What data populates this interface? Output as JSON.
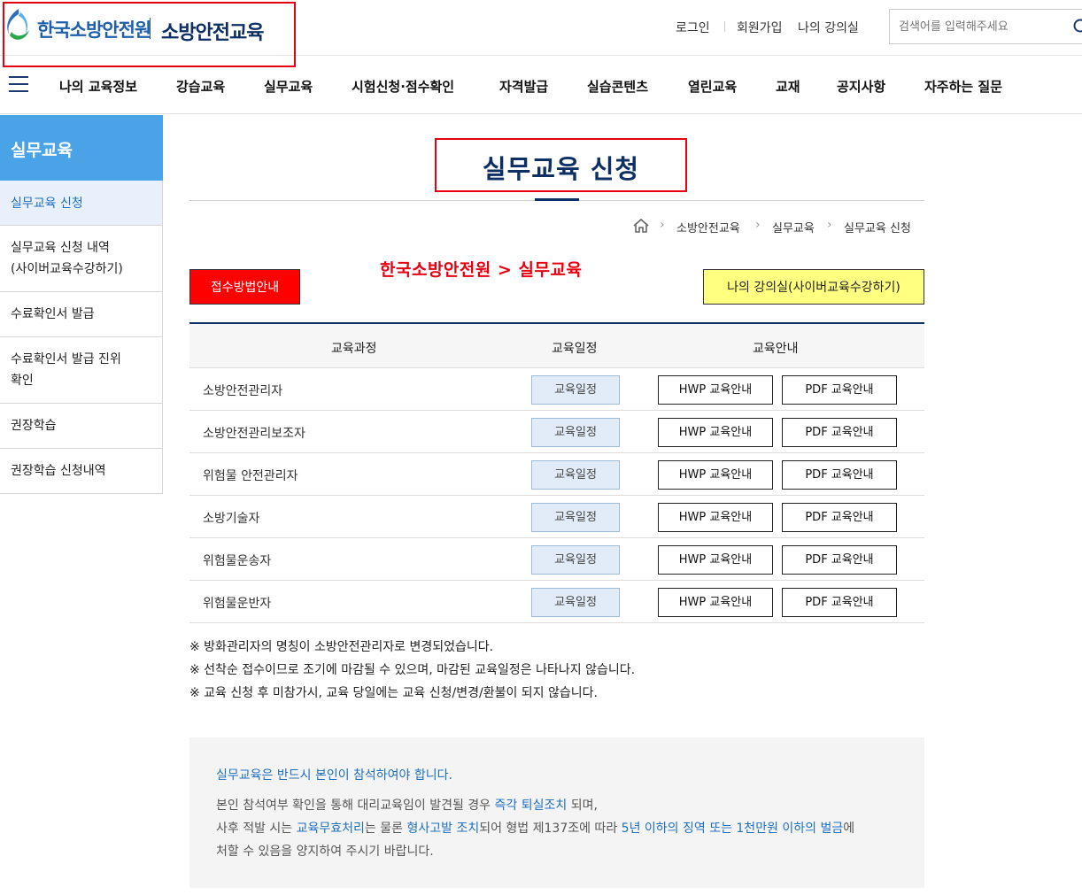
{
  "header": {
    "org_name": "한국소방안전원",
    "site_name": "소방안전교육",
    "util_links": [
      "로그인",
      "회원가입",
      "나의 강의실"
    ],
    "search_placeholder": "검색어를 입력해주세요"
  },
  "gnb": {
    "items": [
      "나의 교육정보",
      "강습교육",
      "실무교육",
      "시험신청·점수확인",
      "자격발급",
      "실습콘텐츠",
      "열린교육",
      "교재",
      "공지사항",
      "자주하는 질문"
    ]
  },
  "sidebar": {
    "title": "실무교육",
    "items": [
      {
        "label": "실무교육 신청",
        "active": true
      },
      {
        "label": "실무교육 신청 내역",
        "label2": "(사이버교육수강하기)"
      },
      {
        "label": "수료확인서 발급"
      },
      {
        "label": "수료확인서 발급 진위",
        "label2": "확인"
      },
      {
        "label": "권장학습"
      },
      {
        "label": "권장학습 신청내역"
      }
    ]
  },
  "main": {
    "title": "실무교육 신청",
    "breadcrumb": [
      "소방안전교육",
      "실무교육",
      "실무교육 신청"
    ],
    "annotation": "한국소방안전원 > 실무교육",
    "receipt_button": "접수방법안내",
    "lecture_button": "나의 강의실(사이버교육수강하기)",
    "table": {
      "headers": [
        "교육과정",
        "교육일정",
        "교육안내"
      ],
      "rows": [
        {
          "course": "소방안전관리자",
          "schedule": "교육일정",
          "hwp": "HWP 교육안내",
          "pdf": "PDF 교육안내"
        },
        {
          "course": "소방안전관리보조자",
          "schedule": "교육일정",
          "hwp": "HWP 교육안내",
          "pdf": "PDF 교육안내"
        },
        {
          "course": "위험물 안전관리자",
          "schedule": "교육일정",
          "hwp": "HWP 교육안내",
          "pdf": "PDF 교육안내"
        },
        {
          "course": "소방기술자",
          "schedule": "교육일정",
          "hwp": "HWP 교육안내",
          "pdf": "PDF 교육안내"
        },
        {
          "course": "위험물운송자",
          "schedule": "교육일정",
          "hwp": "HWP 교육안내",
          "pdf": "PDF 교육안내"
        },
        {
          "course": "위험물운반자",
          "schedule": "교육일정",
          "hwp": "HWP 교육안내",
          "pdf": "PDF 교육안내"
        }
      ]
    },
    "notes": [
      "※ 방화관리자의 명칭이 소방안전관리자로 변경되었습니다.",
      "※ 선착순 접수이므로 조기에 마감될 수 있으며, 마감된 교육일정은 나타나지 않습니다.",
      "※ 교육 신청 후 미참가시, 교육 당일에는 교육 신청/변경/환불이 되지 않습니다."
    ],
    "notice": {
      "line1": "실무교육은 반드시 본인이 참석하여야 합니다.",
      "line2_a": "본인 참석여부 확인을 통해 대리교육임이 발견될 경우 ",
      "line2_hl": "즉각 퇴실조치",
      "line2_b": " 되며,",
      "line3_a": "사후 적발 시는 ",
      "line3_hl1": "교육무효처리",
      "line3_b": "는 물론 ",
      "line3_hl2": "형사고발 조치",
      "line3_c": "되어 형법 제137조에 따라 ",
      "line3_hl3": "5년 이하의 징역 또는 1천만원 이하의 벌금",
      "line3_d": "에",
      "line4": "처할 수 있음을 양지하여 주시기 바랍니다."
    }
  },
  "colors": {
    "brand_navy": "#0d2f63",
    "brand_blue": "#1f5fa8",
    "sidebar_title_bg": "#4aa3e6",
    "highlight_red": "#e60012",
    "lecture_button_bg": "#ffff80"
  }
}
